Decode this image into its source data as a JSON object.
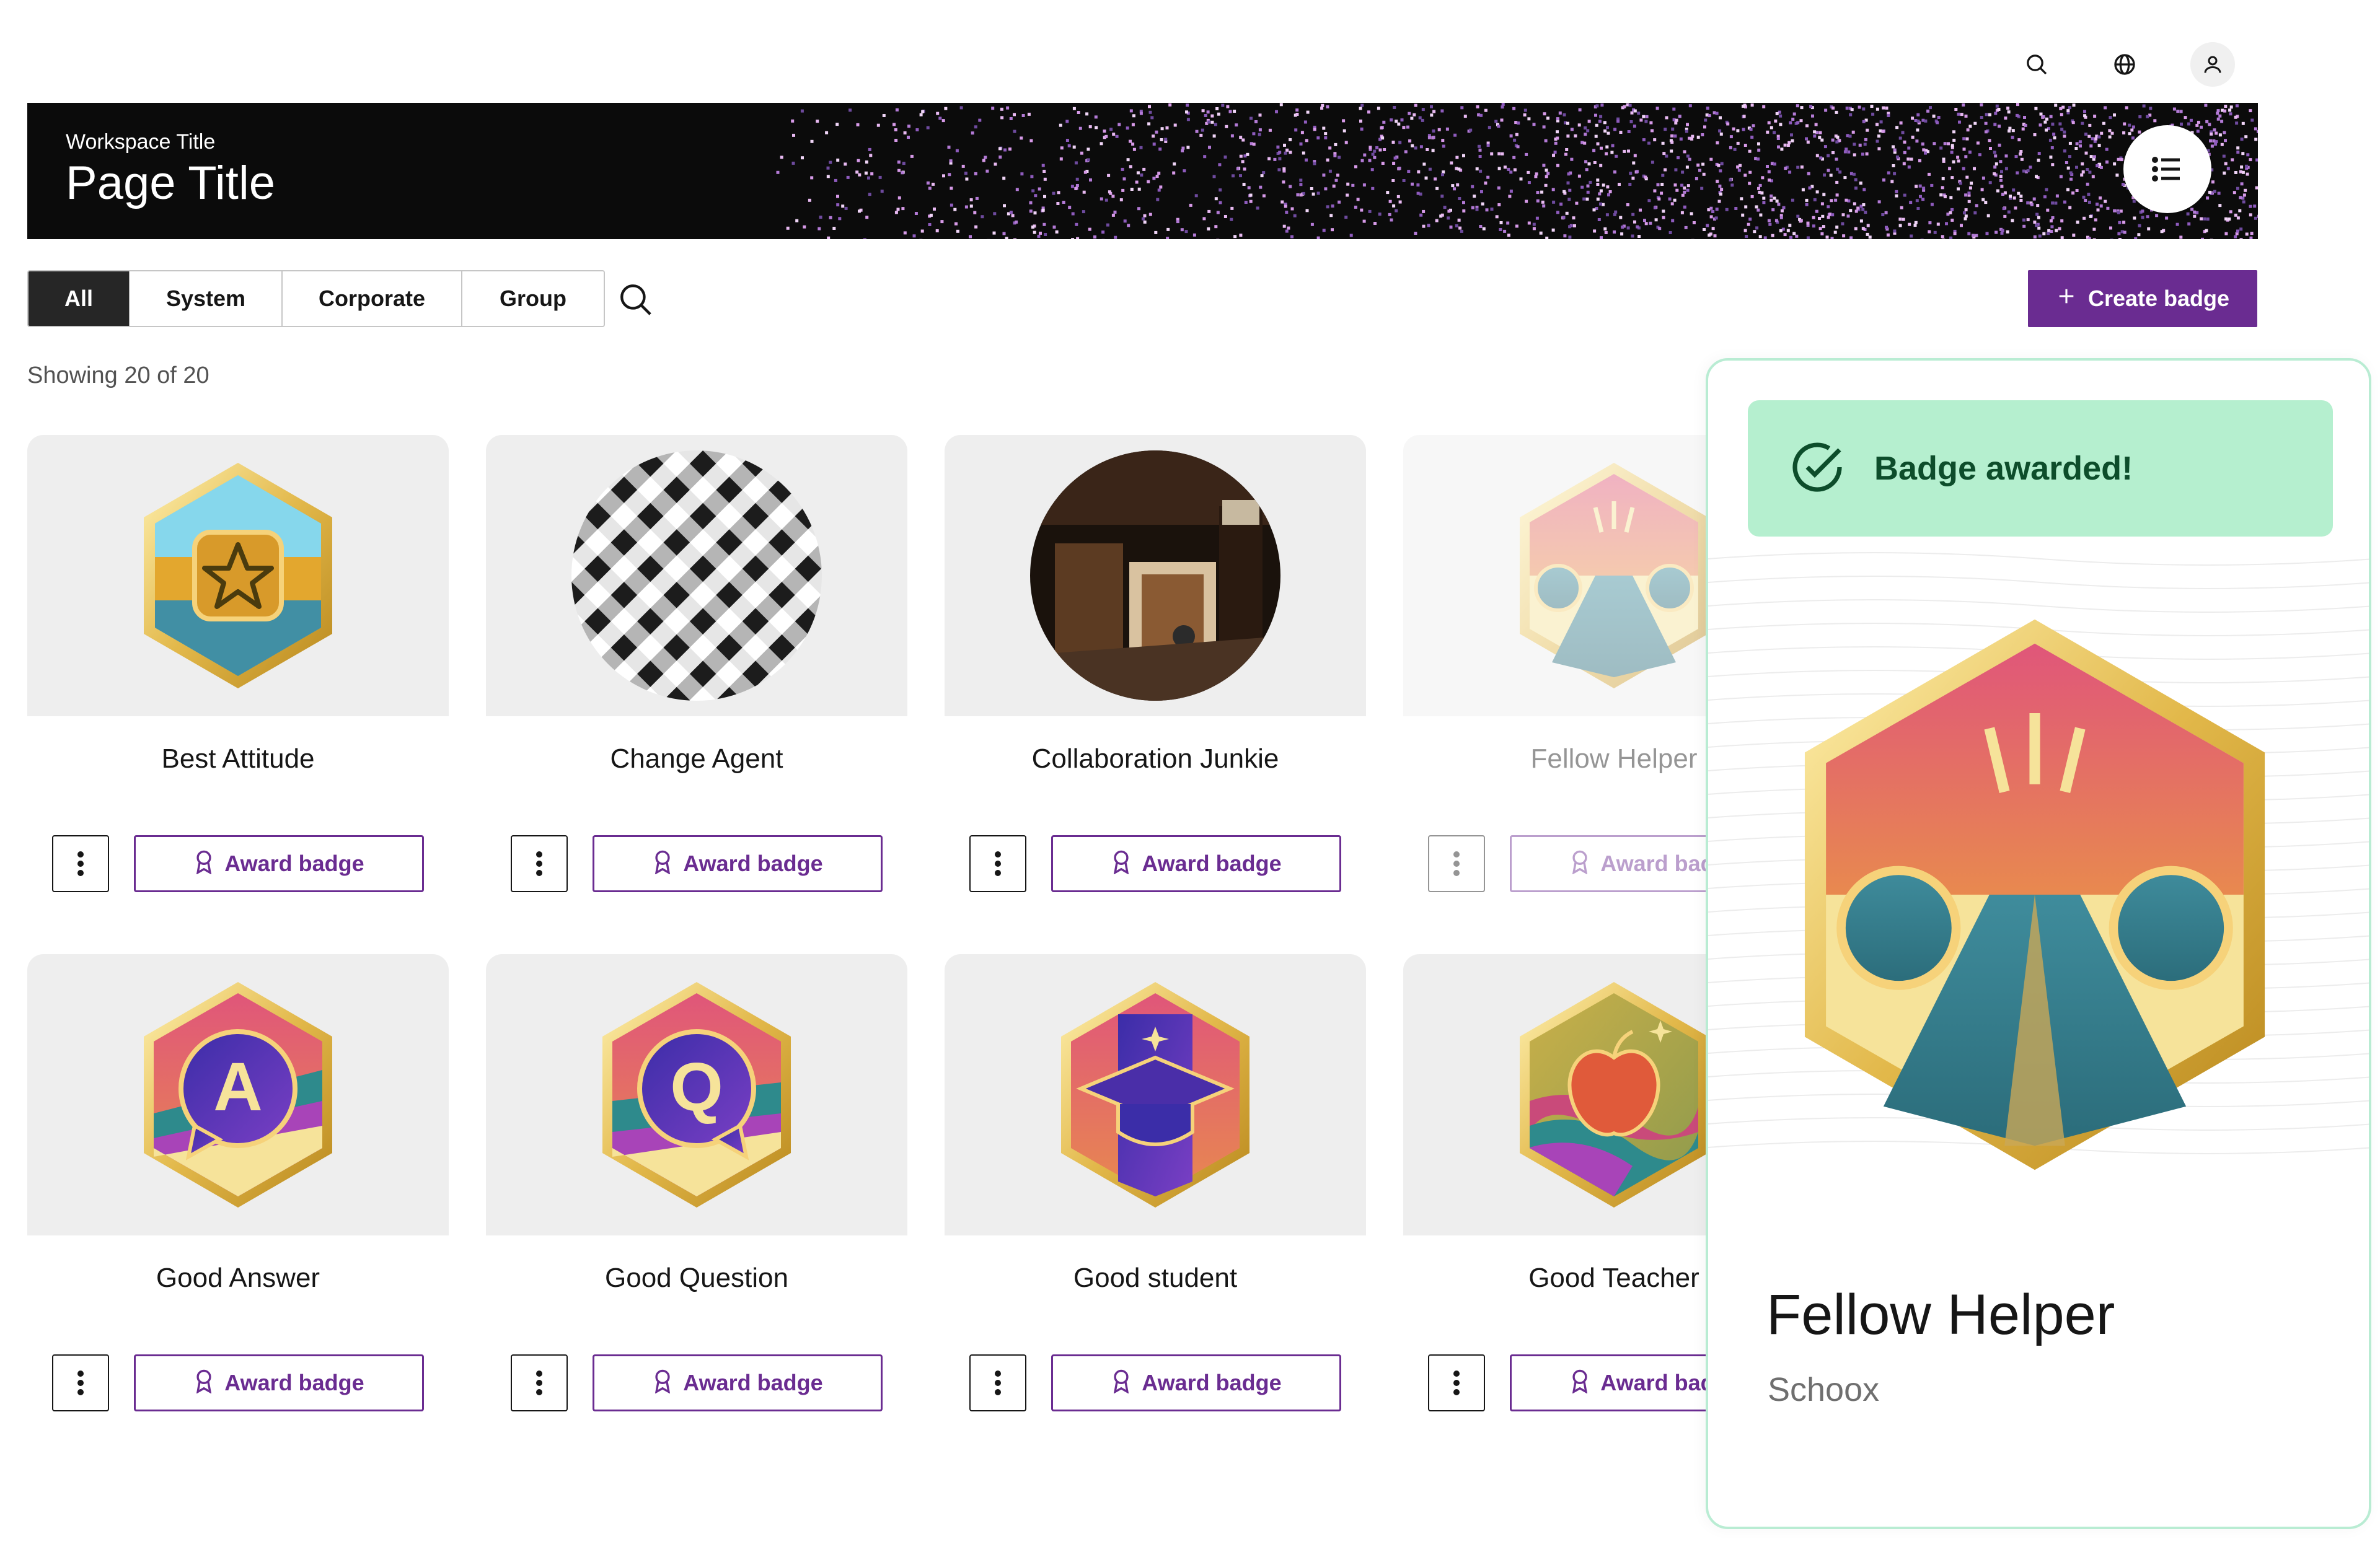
{
  "header": {
    "icons": [
      "search-icon",
      "globe-icon",
      "user-icon"
    ],
    "workspace_title": "Workspace Title",
    "page_title": "Page Title",
    "menu_icon": "list-icon"
  },
  "filters": {
    "tabs": [
      {
        "label": "All",
        "active": true
      },
      {
        "label": "System",
        "active": false
      },
      {
        "label": "Corporate",
        "active": false
      },
      {
        "label": "Group",
        "active": false
      }
    ],
    "search_icon": "search-icon",
    "create_label": "Create badge"
  },
  "results": {
    "showing": "Showing 20 of 20"
  },
  "badges": [
    {
      "name": "Best Attitude",
      "award_label": "Award badge"
    },
    {
      "name": "Change Agent",
      "award_label": "Award badge"
    },
    {
      "name": "Collaboration Junkie",
      "award_label": "Award badge"
    },
    {
      "name": "Fellow Helper",
      "award_label": "Award badge"
    },
    {
      "name": "Good Answer",
      "award_label": "Award badge"
    },
    {
      "name": "Good Question",
      "award_label": "Award badge"
    },
    {
      "name": "Good student",
      "award_label": "Award badge"
    },
    {
      "name": "Good Teacher",
      "award_label": "Award badge"
    }
  ],
  "panel": {
    "toast": "Badge awarded!",
    "badge_name": "Fellow Helper",
    "issuer": "Schoox"
  },
  "colors": {
    "accent": "#6a2c91",
    "success_bg": "#b5efcf",
    "success_text": "#0d4d2b",
    "tab_active": "#262626"
  }
}
